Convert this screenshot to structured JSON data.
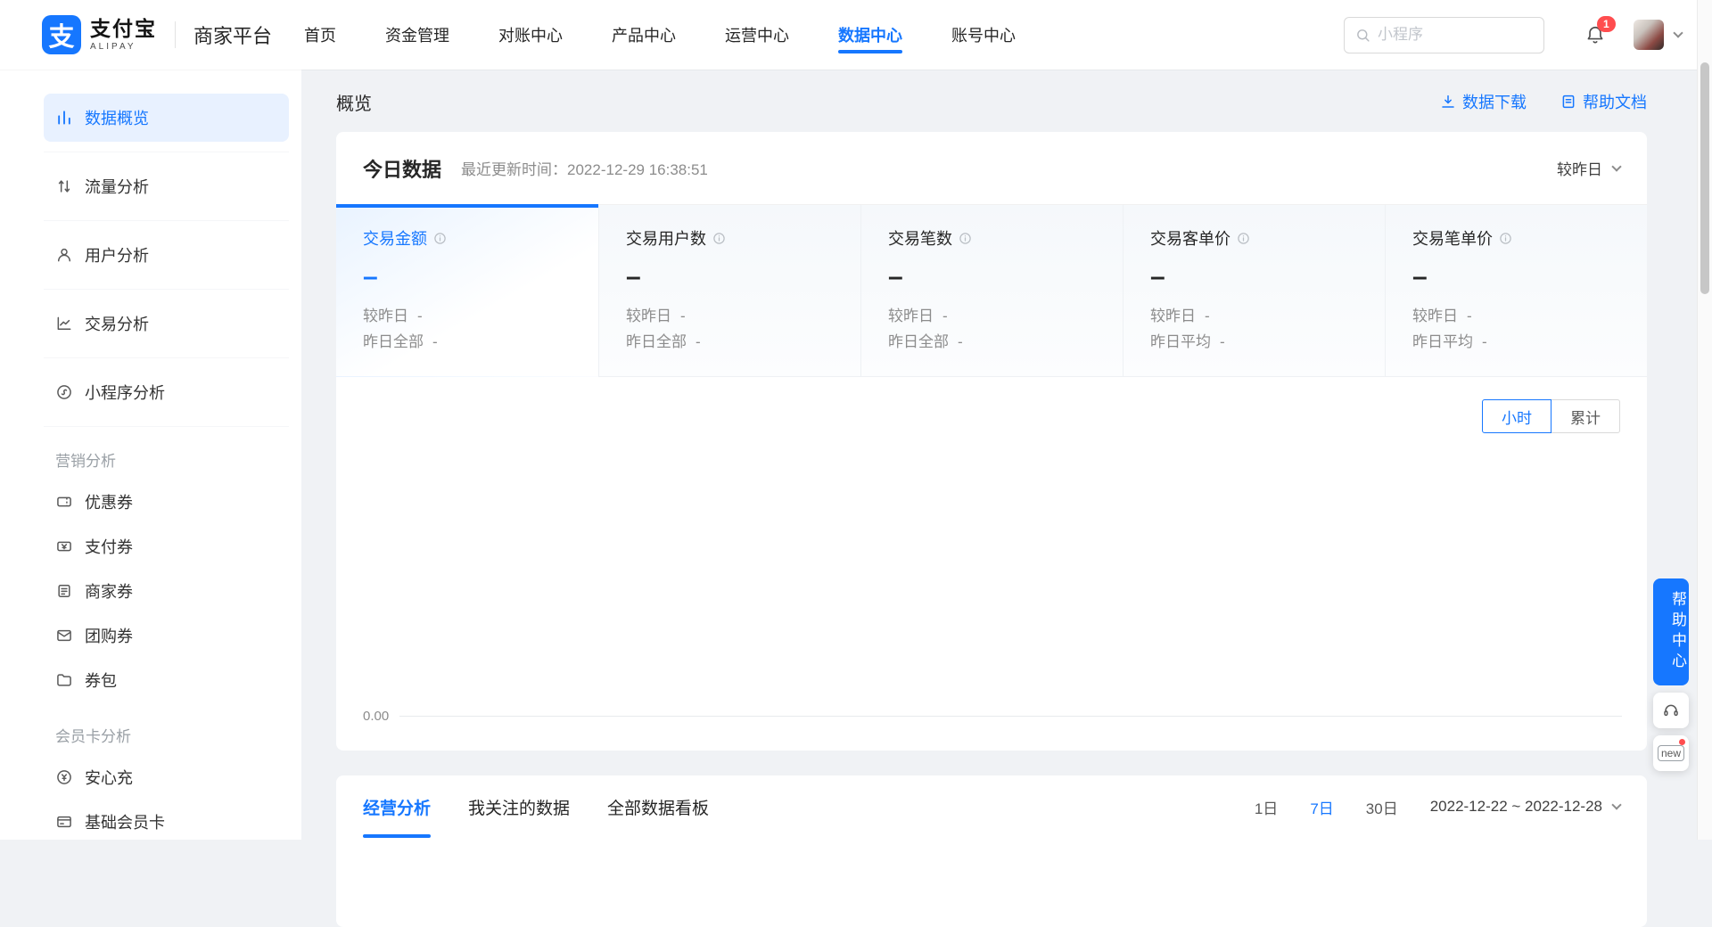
{
  "colors": {
    "brand": "#1677ff",
    "badge_red": "#ff4d4f",
    "active_item_bg": "#e8f1ff"
  },
  "header": {
    "logo_mark": "支",
    "logo_zh": "支付宝",
    "logo_en": "ALIPAY",
    "platform": "商家平台",
    "nav": [
      {
        "label": "首页"
      },
      {
        "label": "资金管理"
      },
      {
        "label": "对账中心"
      },
      {
        "label": "产品中心"
      },
      {
        "label": "运营中心"
      },
      {
        "label": "数据中心"
      },
      {
        "label": "账号中心"
      }
    ],
    "search_placeholder": "小程序",
    "notification_count": "1"
  },
  "sidebar": {
    "main_items": [
      {
        "label": "数据概览",
        "icon": "bar-chart-icon"
      },
      {
        "label": "流量分析",
        "icon": "traffic-icon"
      },
      {
        "label": "用户分析",
        "icon": "user-icon"
      },
      {
        "label": "交易分析",
        "icon": "trend-icon"
      },
      {
        "label": "小程序分析",
        "icon": "miniprogram-icon"
      }
    ],
    "marketing_title": "营销分析",
    "marketing_items": [
      {
        "label": "优惠券",
        "icon": "coupon-icon"
      },
      {
        "label": "支付券",
        "icon": "pay-coupon-icon"
      },
      {
        "label": "商家券",
        "icon": "merchant-coupon-icon"
      },
      {
        "label": "团购券",
        "icon": "group-coupon-icon"
      },
      {
        "label": "券包",
        "icon": "coupon-pack-icon"
      }
    ],
    "member_title": "会员卡分析",
    "member_items": [
      {
        "label": "安心充",
        "icon": "recharge-icon"
      },
      {
        "label": "基础会员卡",
        "icon": "member-card-icon"
      }
    ]
  },
  "page": {
    "title": "概览",
    "download_label": "数据下载",
    "help_doc_label": "帮助文档"
  },
  "today": {
    "title": "今日数据",
    "update_label": "最近更新时间：",
    "update_time": "2022-12-29 16:38:51",
    "compare_label": "较昨日",
    "metrics": [
      {
        "label": "交易金额",
        "value": "–",
        "r1_label": "较昨日",
        "r1_value": "-",
        "r2_label": "昨日全部",
        "r2_value": "-"
      },
      {
        "label": "交易用户数",
        "value": "–",
        "r1_label": "较昨日",
        "r1_value": "-",
        "r2_label": "昨日全部",
        "r2_value": "-"
      },
      {
        "label": "交易笔数",
        "value": "–",
        "r1_label": "较昨日",
        "r1_value": "-",
        "r2_label": "昨日全部",
        "r2_value": "-"
      },
      {
        "label": "交易客单价",
        "value": "–",
        "r1_label": "较昨日",
        "r1_value": "-",
        "r2_label": "昨日平均",
        "r2_value": "-"
      },
      {
        "label": "交易笔单价",
        "value": "–",
        "r1_label": "较昨日",
        "r1_value": "-",
        "r2_label": "昨日平均",
        "r2_value": "-"
      }
    ],
    "chart": {
      "toggle_hour": "小时",
      "toggle_cumulative": "累计",
      "y_axis_min": "0.00"
    }
  },
  "analysis": {
    "tabs": [
      {
        "label": "经营分析"
      },
      {
        "label": "我关注的数据"
      },
      {
        "label": "全部数据看板"
      }
    ],
    "ranges": [
      {
        "label": "1日"
      },
      {
        "label": "7日"
      },
      {
        "label": "30日"
      }
    ],
    "date_range": "2022-12-22 ~ 2022-12-28"
  },
  "floating": {
    "help_center": "帮助中心",
    "new_label": "new"
  }
}
